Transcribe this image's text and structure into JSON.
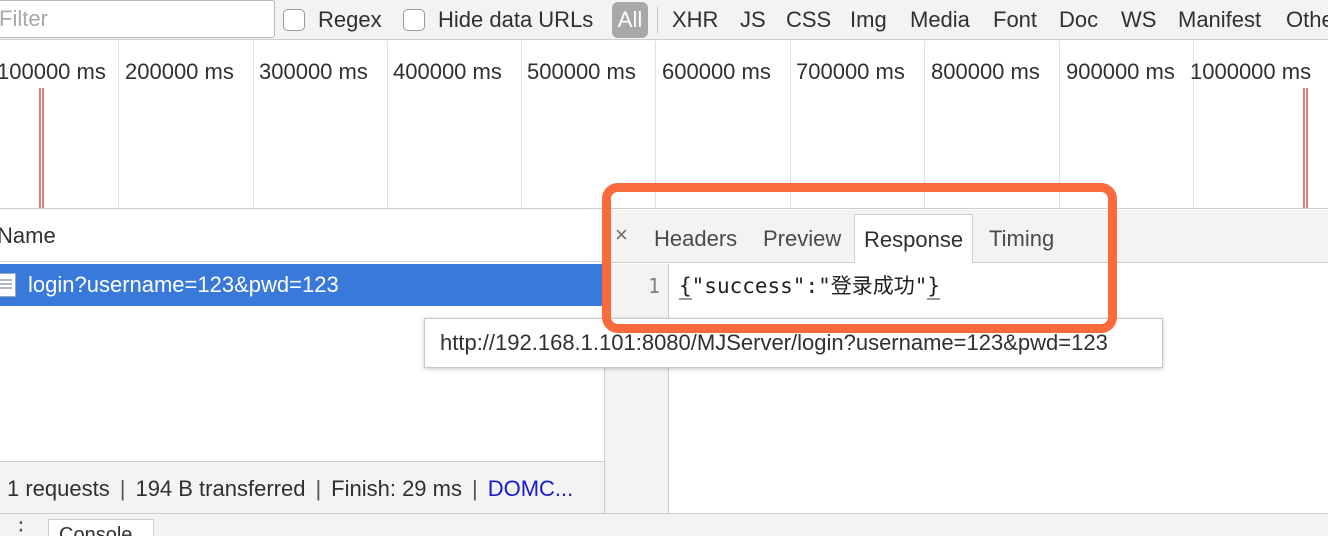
{
  "toolbar": {
    "filter_placeholder": "Filter",
    "regex_label": "Regex",
    "hide_data_urls_label": "Hide data URLs",
    "types": [
      "All",
      "XHR",
      "JS",
      "CSS",
      "Img",
      "Media",
      "Font",
      "Doc",
      "WS",
      "Manifest",
      "Othe"
    ]
  },
  "overview": {
    "ticks": [
      "100000 ms",
      "200000 ms",
      "300000 ms",
      "400000 ms",
      "500000 ms",
      "600000 ms",
      "700000 ms",
      "800000 ms",
      "900000 ms",
      "1000000 ms"
    ]
  },
  "request_list": {
    "column_name": "Name",
    "requests": [
      {
        "name": "login?username=123&pwd=123",
        "url": "http://192.168.1.101:8080/MJServer/login?username=123&pwd=123"
      }
    ]
  },
  "status_bar": {
    "requests": "1 requests",
    "transferred": "194 B transferred",
    "finish": "Finish: 29 ms",
    "dom_link": "DOMC..."
  },
  "detail": {
    "close_glyph": "×",
    "tabs": [
      "Headers",
      "Preview",
      "Response",
      "Timing"
    ],
    "selected_tab": "Response",
    "response": {
      "line_number": "1",
      "open_brace": "{",
      "body": "\"success\":\"登录成功\"",
      "close_brace": "}"
    }
  },
  "drawer": {
    "menu_glyph": "⋮",
    "tab_label": "Console"
  },
  "colors": {
    "selected_row": "#3879d9",
    "highlight_box": "#fb6a3d",
    "event_line": "#e77b7b",
    "link": "#1a1acc"
  }
}
